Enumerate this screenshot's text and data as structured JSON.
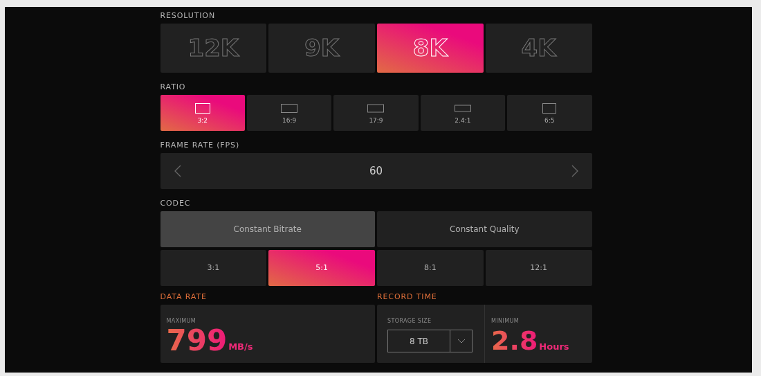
{
  "resolution": {
    "label": "RESOLUTION",
    "options": [
      {
        "label": "12K",
        "selected": false
      },
      {
        "label": "9K",
        "selected": false
      },
      {
        "label": "8K",
        "selected": true
      },
      {
        "label": "4K",
        "selected": false
      }
    ]
  },
  "ratio": {
    "label": "RATIO",
    "options": [
      {
        "label": "3:2",
        "selected": true
      },
      {
        "label": "16:9",
        "selected": false
      },
      {
        "label": "17:9",
        "selected": false
      },
      {
        "label": "2.4:1",
        "selected": false
      },
      {
        "label": "6:5",
        "selected": false
      }
    ]
  },
  "frame_rate": {
    "label": "FRAME RATE (FPS)",
    "value": "60"
  },
  "codec": {
    "label": "CODEC",
    "modes": [
      {
        "label": "Constant Bitrate",
        "selected": true
      },
      {
        "label": "Constant Quality",
        "selected": false
      }
    ],
    "ratios": [
      {
        "label": "3:1",
        "selected": false
      },
      {
        "label": "5:1",
        "selected": true
      },
      {
        "label": "8:1",
        "selected": false
      },
      {
        "label": "12:1",
        "selected": false
      }
    ]
  },
  "data_rate": {
    "label": "DATA RATE",
    "caption": "MAXIMUM",
    "value": "799",
    "unit": "MB/s"
  },
  "record_time": {
    "label": "RECORD TIME",
    "storage_label": "STORAGE SIZE",
    "storage_value": "8 TB",
    "caption": "MINIMUM",
    "value": "2.8",
    "unit": "Hours"
  }
}
